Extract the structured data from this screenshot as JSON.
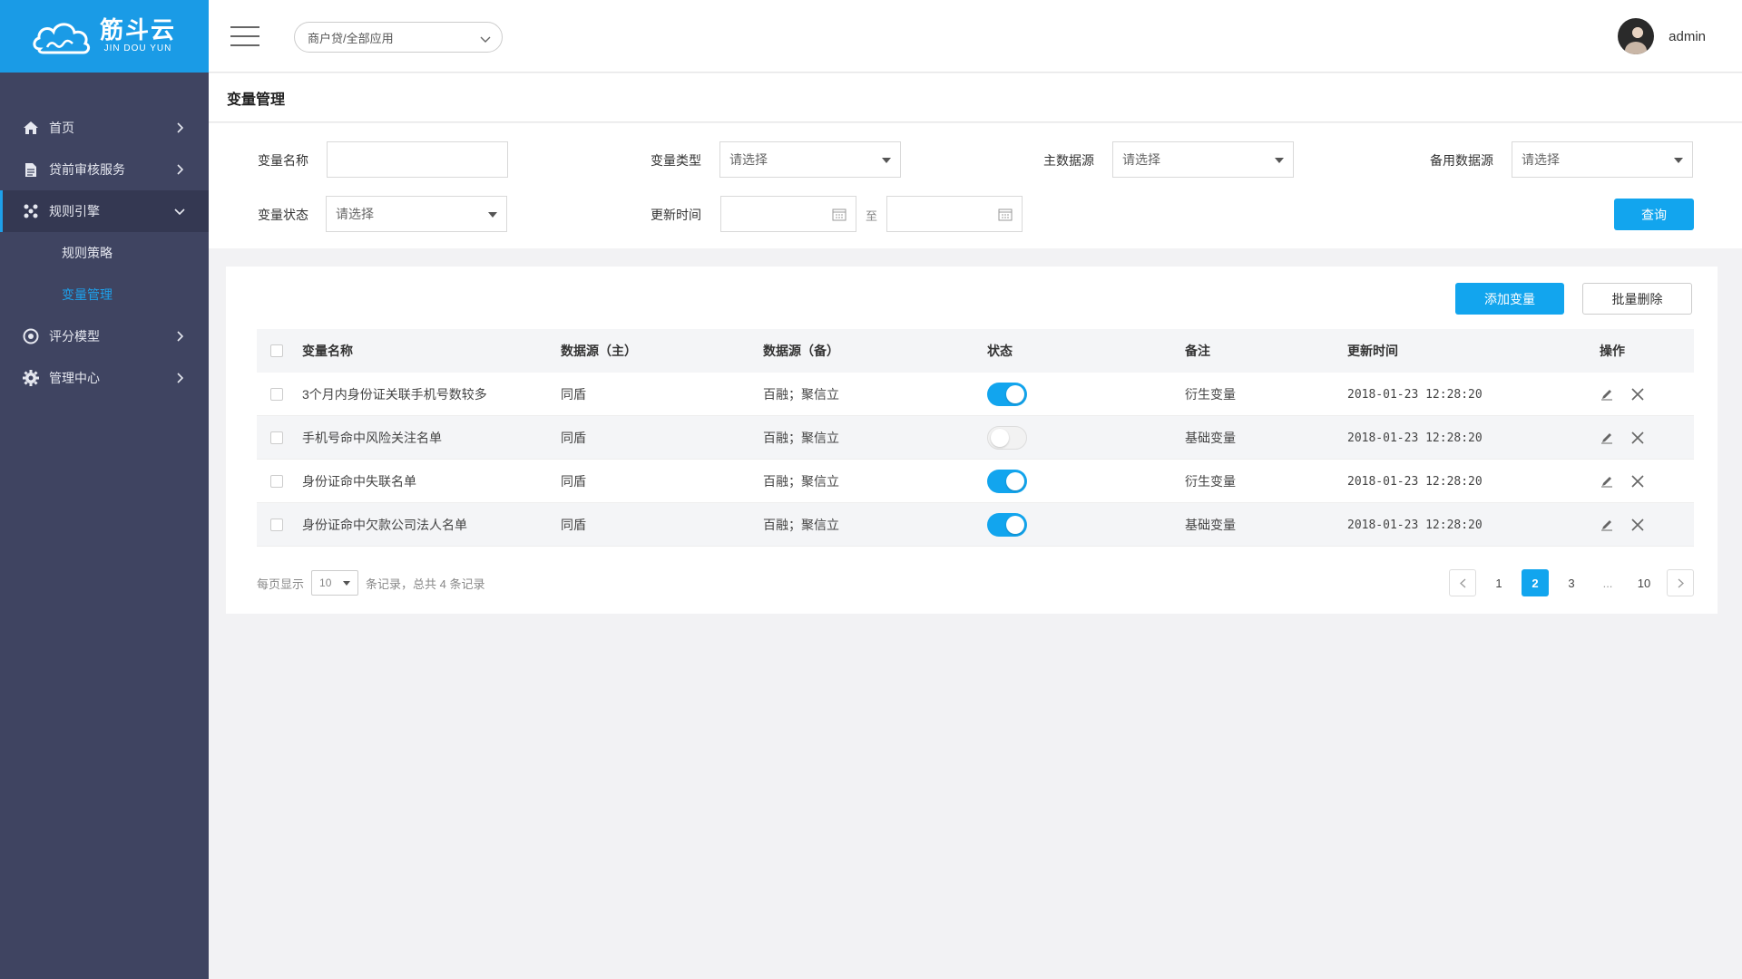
{
  "logo": {
    "main": "筋斗云",
    "sub": "JIN DOU YUN"
  },
  "colors": {
    "brand": "#1a9be6",
    "accent": "#12a5ee",
    "sidebar": "#3f4461"
  },
  "sidebar": {
    "items": [
      {
        "label": "首页",
        "icon": "home-icon"
      },
      {
        "label": "贷前审核服务",
        "icon": "document-icon"
      },
      {
        "label": "规则引擎",
        "icon": "rules-icon",
        "active": true,
        "children": [
          {
            "label": "规则策略"
          },
          {
            "label": "变量管理",
            "current": true
          }
        ]
      },
      {
        "label": "评分模型",
        "icon": "target-icon"
      },
      {
        "label": "管理中心",
        "icon": "gear-icon"
      }
    ]
  },
  "header": {
    "app_select": "商户贷/全部应用",
    "username": "admin"
  },
  "page": {
    "title": "变量管理"
  },
  "filters": {
    "name_label": "变量名称",
    "type_label": "变量类型",
    "type_value": "请选择",
    "primary_label": "主数据源",
    "primary_value": "请选择",
    "backup_label": "备用数据源",
    "backup_value": "请选择",
    "status_label": "变量状态",
    "status_value": "请选择",
    "time_label": "更新时间",
    "to_label": "至",
    "query_button": "查询"
  },
  "toolbar": {
    "add_label": "添加变量",
    "batch_delete_label": "批量删除"
  },
  "table": {
    "headers": [
      "变量名称",
      "数据源（主）",
      "数据源（备）",
      "状态",
      "备注",
      "更新时间",
      "操作"
    ],
    "rows": [
      {
        "name": "3个月内身份证关联手机号数较多",
        "primary": "同盾",
        "backup": "百融；聚信立",
        "enabled": true,
        "note": "衍生变量",
        "time": "2018-01-23 12:28:20"
      },
      {
        "name": "手机号命中风险关注名单",
        "primary": "同盾",
        "backup": "百融；聚信立",
        "enabled": false,
        "note": "基础变量",
        "time": "2018-01-23 12:28:20"
      },
      {
        "name": "身份证命中失联名单",
        "primary": "同盾",
        "backup": "百融；聚信立",
        "enabled": true,
        "note": "衍生变量",
        "time": "2018-01-23 12:28:20"
      },
      {
        "name": "身份证命中欠款公司法人名单",
        "primary": "同盾",
        "backup": "百融；聚信立",
        "enabled": true,
        "note": "基础变量",
        "time": "2018-01-23 12:28:20"
      }
    ]
  },
  "pagination": {
    "per_page_label": "每页显示",
    "per_page_value": "10",
    "summary_text": "条记录，总共 4 条记录",
    "pages": [
      "1",
      "2",
      "3",
      "...",
      "10"
    ],
    "current": "2"
  }
}
